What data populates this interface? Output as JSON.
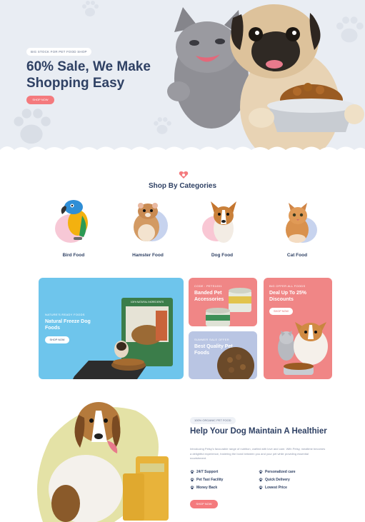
{
  "hero": {
    "tag": "BIG STOCK FOR PET FOOD SHOP",
    "title": "60% Sale, We Make Shopping Easy",
    "button": "SHOP NOW"
  },
  "categories": {
    "title": "Shop By Categories",
    "items": [
      {
        "label": "Bird Food",
        "icon": "parrot"
      },
      {
        "label": "Hamster Food",
        "icon": "hamster"
      },
      {
        "label": "Dog Food",
        "icon": "corgi"
      },
      {
        "label": "Cat Food",
        "icon": "kitten"
      }
    ]
  },
  "promos": {
    "freeze": {
      "small": "NATURE'S READY FOODS",
      "head": "Natural Freeze Dog Foods",
      "button": "SHOP NOW",
      "bag_text": "100% NATURAL INGREDIENTS"
    },
    "banded": {
      "small": "CODE : PETS1001",
      "head": "Banded Pet Accessories"
    },
    "bigoffer": {
      "small": "BIG OFFER ALL FOODS",
      "head": "Deal Up To 25% Discounts",
      "button": "SHOP NOW"
    },
    "quality": {
      "small": "SUMMER SALE OFFER",
      "head": "Best Quality Pet Foods"
    }
  },
  "dog_section": {
    "tag": "100% ORGANIC PET FOOD",
    "title": "Help Your Dog Maintain A Healthier",
    "description": "Introducing Petsy's favourable range of nutrition, crafted with love and care. With Petsy, mealtime becomes a delightful experience, fostering the bond between you and your pet while providing essential nourishment.",
    "features": [
      "24/7 Support",
      "Personalized care",
      "Pet Taxi Facility",
      "Quick Delivery",
      "Money Back",
      "Lowest Price"
    ],
    "button": "SHOP NOW"
  },
  "colors": {
    "accent": "#f47a7d",
    "navy": "#2f4164",
    "blue": "#6ec5ec",
    "lavender": "#b9c5e3",
    "pink": "#f4a8a3",
    "coral": "#f08686"
  }
}
